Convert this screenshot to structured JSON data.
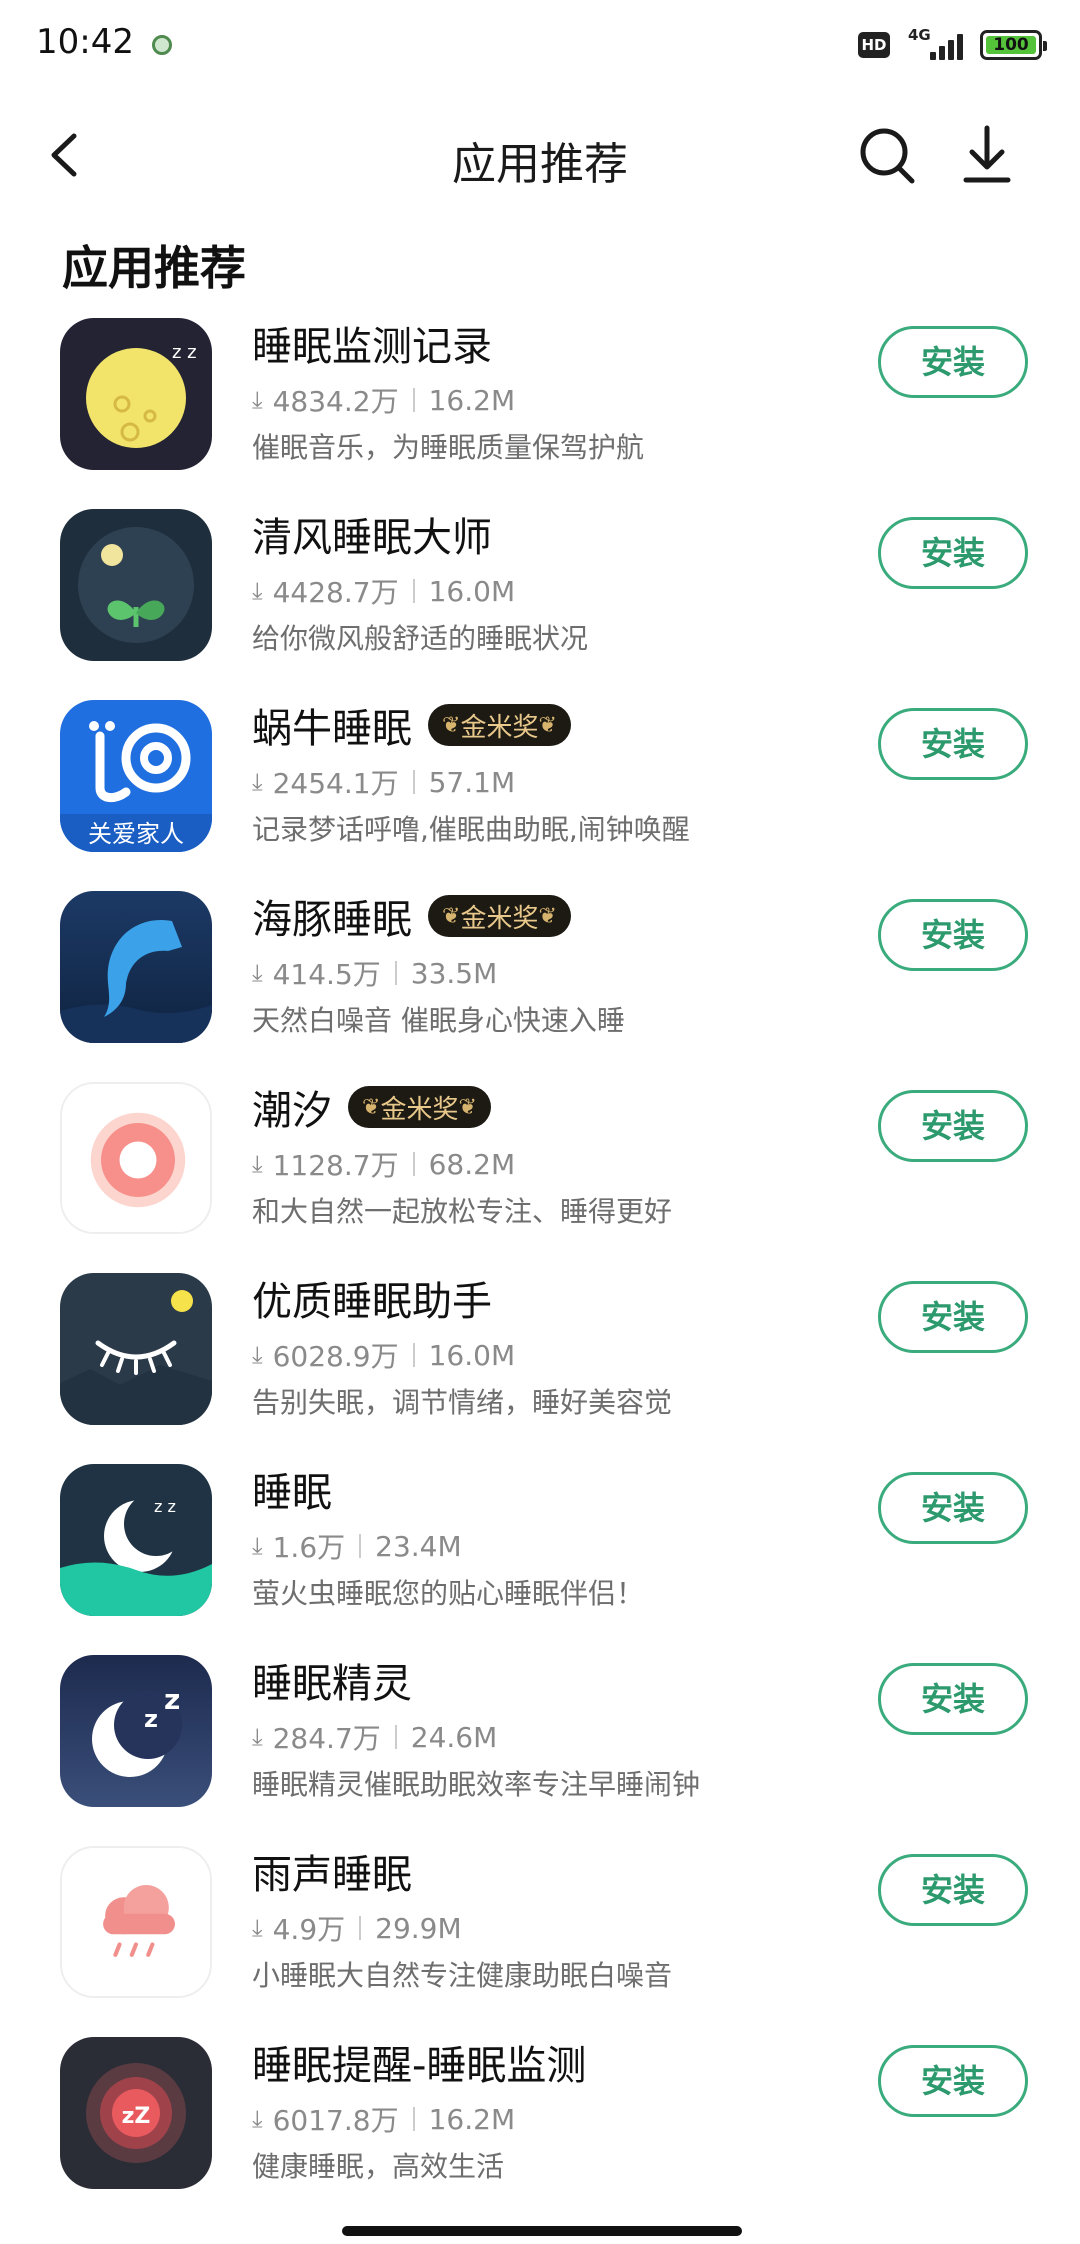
{
  "status_bar": {
    "time": "10:42",
    "hd_label": "HD",
    "network_label": "4G",
    "battery_level": "100"
  },
  "nav": {
    "title": "应用推荐",
    "back_icon": "chevron-left-icon",
    "search_icon": "search-icon",
    "download_icon": "download-icon"
  },
  "section_title": "应用推荐",
  "colors": {
    "accent": "#3aab7c",
    "award_bg": "#1d1a14",
    "award_text": "#e9c98b"
  },
  "apps": [
    {
      "name": "睡眠监测记录",
      "award": "",
      "downloads": "4834.2万",
      "size": "16.2M",
      "desc": "催眠音乐，为睡眠质量保驾护航",
      "install_label": "安装",
      "icon": "moon-face-icon"
    },
    {
      "name": "清风睡眠大师",
      "award": "",
      "downloads": "4428.7万",
      "size": "16.0M",
      "desc": "给你微风般舒适的睡眠状况",
      "install_label": "安装",
      "icon": "sprout-moon-icon"
    },
    {
      "name": "蜗牛睡眠",
      "award": "金米奖",
      "downloads": "2454.1万",
      "size": "57.1M",
      "desc": "记录梦话呼噜,催眠曲助眠,闹钟唤醒",
      "install_label": "安装",
      "icon": "snail-icon",
      "icon_caption": "关爱家人"
    },
    {
      "name": "海豚睡眠",
      "award": "金米奖",
      "downloads": "414.5万",
      "size": "33.5M",
      "desc": "天然白噪音 催眠身心快速入睡",
      "install_label": "安装",
      "icon": "dolphin-icon"
    },
    {
      "name": "潮汐",
      "award": "金米奖",
      "downloads": "1128.7万",
      "size": "68.2M",
      "desc": "和大自然一起放松专注、睡得更好",
      "install_label": "安装",
      "icon": "tide-ring-icon"
    },
    {
      "name": "优质睡眠助手",
      "award": "",
      "downloads": "6028.9万",
      "size": "16.0M",
      "desc": "告别失眠，调节情绪，睡好美容觉",
      "install_label": "安装",
      "icon": "closed-eye-icon"
    },
    {
      "name": "睡眠",
      "award": "",
      "downloads": "1.6万",
      "size": "23.4M",
      "desc": "萤火虫睡眠您的贴心睡眠伴侣！",
      "install_label": "安装",
      "icon": "crescent-wave-icon"
    },
    {
      "name": "睡眠精灵",
      "award": "",
      "downloads": "284.7万",
      "size": "24.6M",
      "desc": "睡眠精灵催眠助眠效率专注早睡闹钟",
      "install_label": "安装",
      "icon": "crescent-zz-icon"
    },
    {
      "name": "雨声睡眠",
      "award": "",
      "downloads": "4.9万",
      "size": "29.9M",
      "desc": "小睡眠大自然专注健康助眠白噪音",
      "install_label": "安装",
      "icon": "rain-cloud-icon"
    },
    {
      "name": "睡眠提醒-睡眠监测",
      "award": "",
      "downloads": "6017.8万",
      "size": "16.2M",
      "desc": "健康睡眠，高效生活",
      "install_label": "安装",
      "icon": "zzz-orb-icon"
    }
  ]
}
